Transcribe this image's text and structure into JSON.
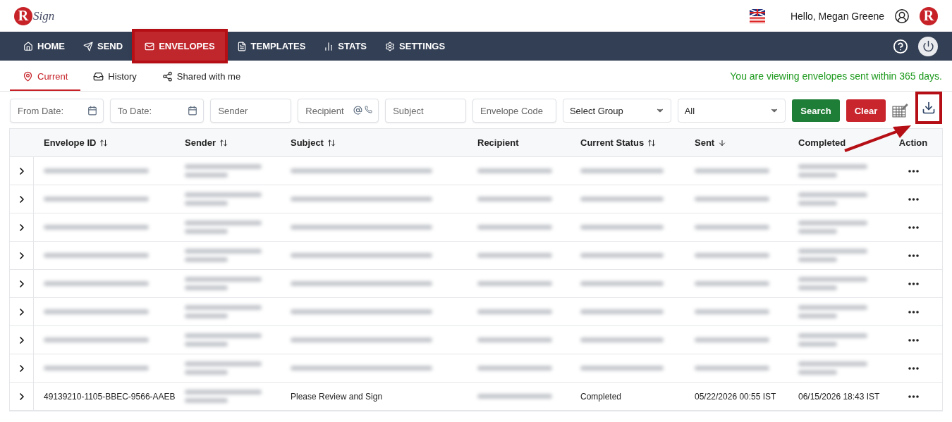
{
  "logo": {
    "mark": "R",
    "text": "Sign"
  },
  "header": {
    "greeting": "Hello, Megan Greene",
    "avatar_letter": "R"
  },
  "nav": [
    {
      "label": "HOME",
      "selected": false,
      "highlighted": false
    },
    {
      "label": "SEND",
      "selected": false,
      "highlighted": false
    },
    {
      "label": "ENVELOPES",
      "selected": true,
      "highlighted": true
    },
    {
      "label": "TEMPLATES",
      "selected": false,
      "highlighted": false
    },
    {
      "label": "STATS",
      "selected": false,
      "highlighted": false
    },
    {
      "label": "SETTINGS",
      "selected": false,
      "highlighted": false
    }
  ],
  "subtabs": [
    {
      "label": "Current",
      "selected": true
    },
    {
      "label": "History",
      "selected": false
    },
    {
      "label": "Shared with me",
      "selected": false
    }
  ],
  "notice": "You are viewing envelopes sent within 365 days.",
  "filters": [
    {
      "kind": "date",
      "placeholder": "From Date:"
    },
    {
      "kind": "date",
      "placeholder": "To Date:"
    },
    {
      "kind": "text",
      "placeholder": "Sender"
    },
    {
      "kind": "contact",
      "placeholder": "Recipient"
    },
    {
      "kind": "text",
      "placeholder": "Subject"
    },
    {
      "kind": "text",
      "placeholder": "Envelope Code"
    },
    {
      "kind": "select",
      "value": "Select Group"
    },
    {
      "kind": "select",
      "value": "All"
    }
  ],
  "buttons": [
    {
      "label": "Search",
      "kind": "primary"
    },
    {
      "label": "Clear",
      "kind": "danger"
    }
  ],
  "download": {
    "highlighted": true,
    "arrow": true
  },
  "table": {
    "columns": [
      {
        "label": "Envelope ID",
        "sortable": true,
        "sorted": false
      },
      {
        "label": "Sender",
        "sortable": true,
        "sorted": false
      },
      {
        "label": "Subject",
        "sortable": true,
        "sorted": false
      },
      {
        "label": "Recipient",
        "sortable": false,
        "sorted": false
      },
      {
        "label": "Current Status",
        "sortable": true,
        "sorted": false
      },
      {
        "label": "Sent",
        "sortable": true,
        "sorted": true
      },
      {
        "label": "Completed",
        "sortable": false,
        "sorted": false
      },
      {
        "label": "Action",
        "sortable": false,
        "sorted": false
      }
    ],
    "rows": [
      {
        "cells": [
          {
            "kind": "blurred"
          },
          {
            "kind": "blurred"
          },
          {
            "kind": "blurred"
          },
          {
            "kind": "blurred"
          },
          {
            "kind": "blurred"
          },
          {
            "kind": "blurred"
          },
          {
            "kind": "blurred"
          }
        ]
      },
      {
        "cells": [
          {
            "kind": "blurred"
          },
          {
            "kind": "blurred"
          },
          {
            "kind": "blurred"
          },
          {
            "kind": "blurred"
          },
          {
            "kind": "blurred"
          },
          {
            "kind": "blurred"
          },
          {
            "kind": "blurred"
          }
        ]
      },
      {
        "cells": [
          {
            "kind": "blurred"
          },
          {
            "kind": "blurred"
          },
          {
            "kind": "blurred"
          },
          {
            "kind": "blurred"
          },
          {
            "kind": "blurred"
          },
          {
            "kind": "blurred"
          },
          {
            "kind": "blurred"
          }
        ]
      },
      {
        "cells": [
          {
            "kind": "blurred"
          },
          {
            "kind": "blurred"
          },
          {
            "kind": "blurred"
          },
          {
            "kind": "blurred"
          },
          {
            "kind": "blurred"
          },
          {
            "kind": "blurred"
          },
          {
            "kind": "blurred"
          }
        ]
      },
      {
        "cells": [
          {
            "kind": "blurred"
          },
          {
            "kind": "blurred"
          },
          {
            "kind": "blurred"
          },
          {
            "kind": "blurred"
          },
          {
            "kind": "blurred"
          },
          {
            "kind": "blurred"
          },
          {
            "kind": "blurred"
          }
        ]
      },
      {
        "cells": [
          {
            "kind": "blurred"
          },
          {
            "kind": "blurred"
          },
          {
            "kind": "blurred"
          },
          {
            "kind": "blurred"
          },
          {
            "kind": "blurred"
          },
          {
            "kind": "blurred"
          },
          {
            "kind": "blurred"
          }
        ]
      },
      {
        "cells": [
          {
            "kind": "blurred"
          },
          {
            "kind": "blurred"
          },
          {
            "kind": "blurred"
          },
          {
            "kind": "blurred"
          },
          {
            "kind": "blurred"
          },
          {
            "kind": "blurred"
          },
          {
            "kind": "blurred"
          }
        ]
      },
      {
        "cells": [
          {
            "kind": "blurred"
          },
          {
            "kind": "blurred"
          },
          {
            "kind": "blurred"
          },
          {
            "kind": "blurred"
          },
          {
            "kind": "blurred"
          },
          {
            "kind": "blurred"
          },
          {
            "kind": "blurred"
          }
        ]
      },
      {
        "cells": [
          {
            "kind": "text",
            "text": "49139210-1105-BBEC-9566-AAEB"
          },
          {
            "kind": "blurred"
          },
          {
            "kind": "text",
            "text": "Please Review and Sign"
          },
          {
            "kind": "blurred"
          },
          {
            "kind": "text",
            "text": "Completed"
          },
          {
            "kind": "text",
            "text": "05/22/2026 00:55 IST"
          },
          {
            "kind": "text",
            "text": "06/15/2026 18:43 IST"
          }
        ]
      }
    ]
  }
}
